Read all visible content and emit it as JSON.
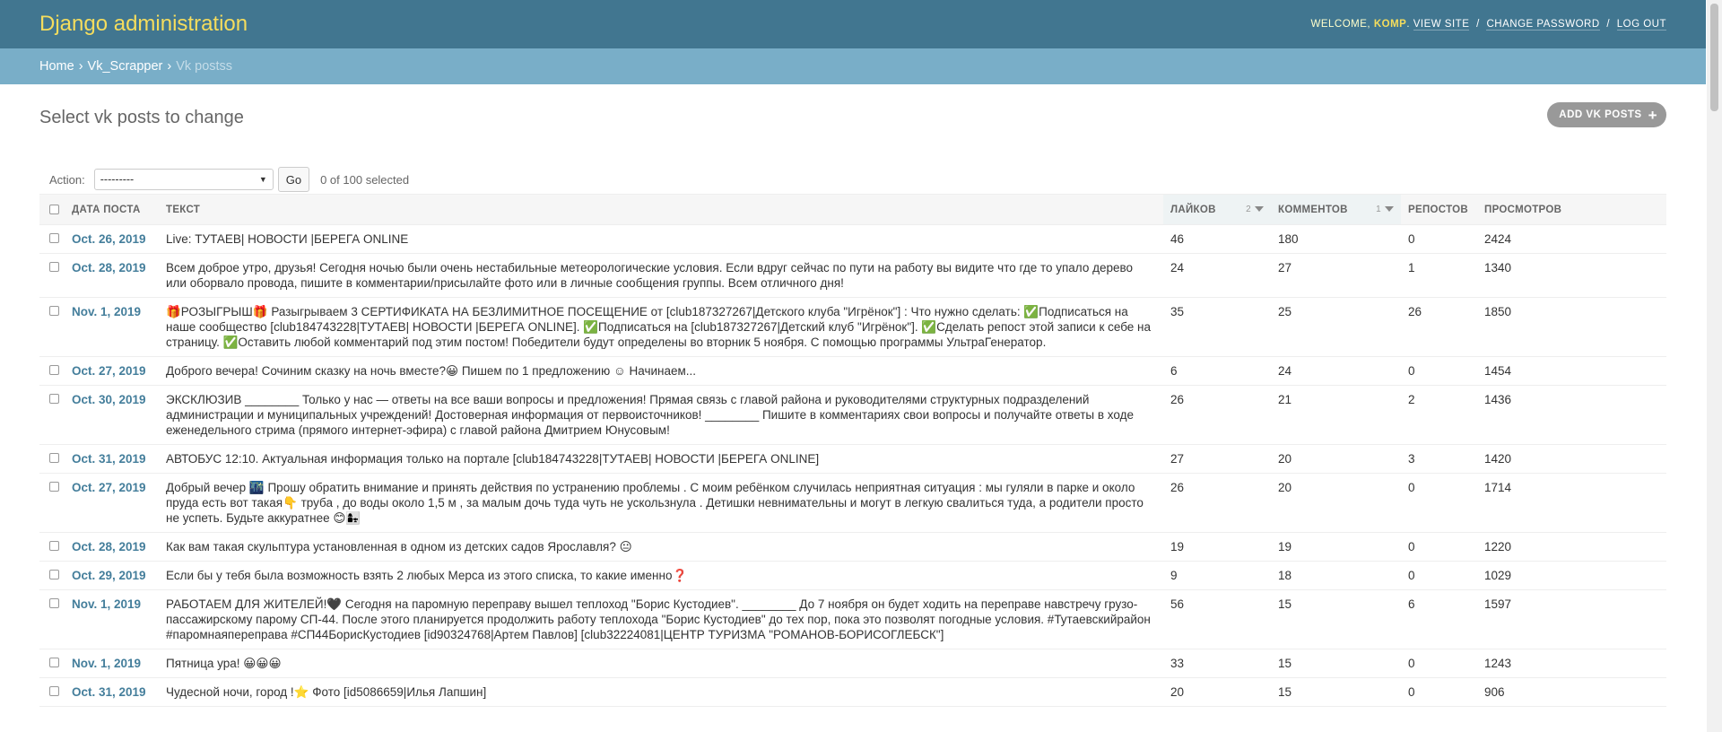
{
  "header": {
    "branding": "Django administration",
    "welcome": "Welcome,",
    "user": "komp",
    "view_site": "View site",
    "change_password": "Change password",
    "log_out": "Log out"
  },
  "breadcrumbs": {
    "home": "Home",
    "app": "Vk_Scrapper",
    "current": "Vk postss"
  },
  "page": {
    "title": "Select vk posts to change",
    "add_button": "Add vk posts",
    "add_icon": "+"
  },
  "actions": {
    "label": "Action:",
    "selected_option": "---------",
    "go": "Go",
    "counter": "0 of 100 selected"
  },
  "table": {
    "headers": {
      "date": "Дата поста",
      "text": "Текст",
      "likes": "Лайков",
      "likes_sort_priority": "2",
      "comments": "Комментов",
      "comments_sort_priority": "1",
      "reposts": "Репостов",
      "views": "Просмотров"
    },
    "rows": [
      {
        "date": "Oct. 26, 2019",
        "text": "Live: ТУТАЕВ| НОВОСТИ |БЕРЕГА ONLINE",
        "likes": "46",
        "comments": "180",
        "reposts": "0",
        "views": "2424"
      },
      {
        "date": "Oct. 28, 2019",
        "text": "Всем доброе утро, друзья! Сегодня ночью были очень нестабильные метеорологические условия. Если вдруг сейчас по пути на работу вы видите что где то упало дерево или оборвало провода, пишите в комментарии/присылайте фото или в личные сообщения группы. Всем отличного дня!",
        "likes": "24",
        "comments": "27",
        "reposts": "1",
        "views": "1340"
      },
      {
        "date": "Nov. 1, 2019",
        "text": "🎁РОЗЫГРЫШ🎁 Разыгрываем 3 СЕРТИФИКАТА НА БЕЗЛИМИТНОЕ ПОСЕЩЕНИЕ от [club187327267|Детского клуба \"Игрёнок\"] : Что нужно сделать: ✅Подписаться на наше сообщество [club184743228|ТУТАЕВ| НОВОСТИ |БЕРЕГА ONLINE]. ✅Подписаться на [club187327267|Детский клуб \"Игрёнок\"]. ✅Сделать репост этой записи к себе на страницу. ✅Оставить любой комментарий под этим постом! Победители будут определены во вторник 5 ноября. С помощью программы УльтраГенератор.",
        "likes": "35",
        "comments": "25",
        "reposts": "26",
        "views": "1850"
      },
      {
        "date": "Oct. 27, 2019",
        "text": "Доброго вечера! Сочиним сказку на ночь вместе?😀 Пишем по 1 предложению ☺ Начинаем...",
        "likes": "6",
        "comments": "24",
        "reposts": "0",
        "views": "1454"
      },
      {
        "date": "Oct. 30, 2019",
        "text": "ЭКСКЛЮЗИВ ________ Только у нас — ответы на все ваши вопросы и предложения! Прямая связь с главой района и руководителями структурных подразделений администрации и муниципальных учреждений! Достоверная информация от первоисточников! ________ Пишите в комментариях свои вопросы и получайте ответы в ходе еженедельного стрима (прямого интернет-эфира) с главой района Дмитрием Юнусовым!",
        "likes": "26",
        "comments": "21",
        "reposts": "2",
        "views": "1436"
      },
      {
        "date": "Oct. 31, 2019",
        "text": "АВТОБУС 12:10. Актуальная информация только на портале [club184743228|ТУТАЕВ| НОВОСТИ |БЕРЕГА ONLINE]",
        "likes": "27",
        "comments": "20",
        "reposts": "3",
        "views": "1420"
      },
      {
        "date": "Oct. 27, 2019",
        "text": "Добрый вечер 🌃 Прошу обратить внимание и принять действия по устранению проблемы . С моим ребёнком случилась неприятная ситуация : мы гуляли в парке и около пруда есть вот такая👇 труба , до воды около 1,5 м , за малым дочь туда чуть не ускользнула . Детишки невнимательны и могут в легкую свалиться туда, а родители просто не успеть. Будьте аккуратнее 😊👩‍👧",
        "likes": "26",
        "comments": "20",
        "reposts": "0",
        "views": "1714"
      },
      {
        "date": "Oct. 28, 2019",
        "text": "Как вам такая скульптура установленная в одном из детских садов Ярославля? 😐",
        "likes": "19",
        "comments": "19",
        "reposts": "0",
        "views": "1220"
      },
      {
        "date": "Oct. 29, 2019",
        "text": "Если бы у тебя была возможность взять 2 любых Мерса из этого списка, то какие именно❓",
        "likes": "9",
        "comments": "18",
        "reposts": "0",
        "views": "1029"
      },
      {
        "date": "Nov. 1, 2019",
        "text": "РАБОТАЕМ ДЛЯ ЖИТЕЛЕЙ!🖤 Сегодня на паромную переправу вышел теплоход \"Борис Кустодиев\". ________ До 7 ноября он будет ходить на переправе навстречу грузо-пассажирскому парому СП-44. После этого планируется продолжить работу теплохода \"Борис Кустодиев\" до тех пор, пока это позволят погодные условия. #Тутаевскийрайон #паромнаяпереправа #СП44БорисКустодиев [id90324768|Артем Павлов] [club32224081|ЦЕНТР ТУРИЗМА \"РОМАНОВ-БОРИСОГЛЕБСК\"]",
        "likes": "56",
        "comments": "15",
        "reposts": "6",
        "views": "1597"
      },
      {
        "date": "Nov. 1, 2019",
        "text": "Пятница ура! 😀😀😀",
        "likes": "33",
        "comments": "15",
        "reposts": "0",
        "views": "1243"
      },
      {
        "date": "Oct. 31, 2019",
        "text": "Чудесной ночи, город !⭐ Фото [id5086659|Илья Лапшин]",
        "likes": "20",
        "comments": "15",
        "reposts": "0",
        "views": "906"
      }
    ]
  }
}
